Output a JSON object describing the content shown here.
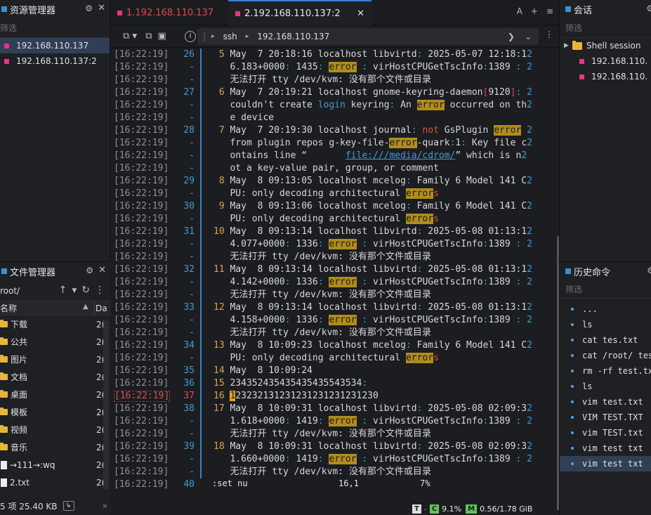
{
  "sessions_left": {
    "title": "资源管理器",
    "filter": "筛选",
    "items": [
      "192.168.110.137",
      "192.168.110.137:2"
    ]
  },
  "file_manager": {
    "title": "文件管理器",
    "path": "root/",
    "col_name": "名称",
    "col_date": "Da",
    "items": [
      {
        "name": "下载",
        "type": "folder",
        "date": "2("
      },
      {
        "name": "公共",
        "type": "folder",
        "date": "2("
      },
      {
        "name": "图片",
        "type": "folder",
        "date": "2("
      },
      {
        "name": "文档",
        "type": "folder",
        "date": "2("
      },
      {
        "name": "桌面",
        "type": "folder",
        "date": "2("
      },
      {
        "name": "模板",
        "type": "folder",
        "date": "2("
      },
      {
        "name": "视频",
        "type": "folder",
        "date": "2("
      },
      {
        "name": "音乐",
        "type": "folder",
        "date": "2("
      },
      {
        "name": "→111→:wq",
        "type": "file",
        "date": "2("
      },
      {
        "name": "2.txt",
        "type": "file",
        "date": "2("
      }
    ],
    "status": "5 项 25.40 KB"
  },
  "tabs": [
    {
      "label": "1.192.168.110.137",
      "active": false
    },
    {
      "label": "2.192.168.110.137:2",
      "active": true
    }
  ],
  "tabs_right": {
    "font_btn": "A",
    "add_btn": "+",
    "more_btn": "≡"
  },
  "address": {
    "protocol": "ssh",
    "host": "192.168.110.137"
  },
  "terminal": {
    "timestamp": "[16:22:19]",
    "cmdline": ":set nu",
    "position": "16,1",
    "percent": "7%"
  },
  "statusbar": {
    "t_badge": "T",
    "c_badge": "C",
    "cpu": "9.1%",
    "m_badge": "M",
    "mem": "0.56/1.78 GiB"
  },
  "right_sessions": {
    "title": "会话",
    "filter": "筛选",
    "group": "Shell session",
    "items": [
      "192.168.110.",
      "192.168.110."
    ]
  },
  "history": {
    "title": "历史命令",
    "filter": "筛选",
    "items": [
      "...",
      "ls",
      "cat tes.txt",
      "cat /root/ tes",
      "rm -rf test.tx",
      "ls",
      "vim test.txt",
      "VIM TEST.TXT",
      "vim TEST.txt",
      "vim test txt",
      "vim test txt"
    ]
  },
  "colors": {
    "accent": "#3a80d9",
    "error_bg": "#b18c1d",
    "line_number": "#3e9cd0",
    "tab_inactive": "#e04a4a"
  }
}
